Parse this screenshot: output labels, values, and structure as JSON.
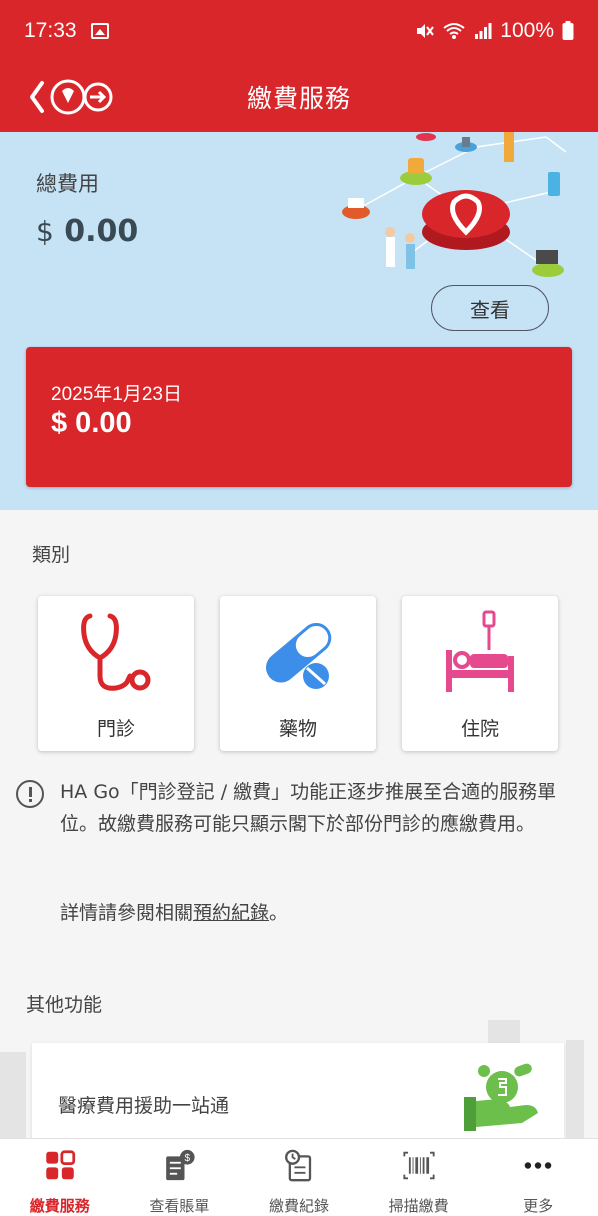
{
  "status_bar": {
    "time": "17:33",
    "battery": "100%"
  },
  "app_bar": {
    "title": "繳費服務"
  },
  "summary": {
    "total_label": "總費用",
    "total_currency": "$",
    "total_amount": "0.00",
    "view_button": "查看"
  },
  "due_card": {
    "date": "2025年1月23日",
    "amount": "$ 0.00"
  },
  "categories": {
    "heading": "類別",
    "items": [
      {
        "label": "門診",
        "icon": "stethoscope-icon",
        "color": "#d9262a"
      },
      {
        "label": "藥物",
        "icon": "pill-capsule-icon",
        "color": "#3d8ee8"
      },
      {
        "label": "住院",
        "icon": "hospital-bed-icon",
        "color": "#e54a8e"
      }
    ]
  },
  "notice": {
    "text": "HA Go「門診登記 / 繳費」功能正逐步推展至合適的服務單位。故繳費服務可能只顯示閣下於部份門診的應繳費用。",
    "more_prefix": "詳情請參閱相關",
    "more_link": "預約紀錄",
    "more_suffix": "。"
  },
  "other_functions": {
    "heading": "其他功能",
    "items": [
      {
        "label": "醫療費用援助一站通",
        "icon": "money-hand-icon"
      }
    ]
  },
  "bottom_nav": {
    "items": [
      {
        "label": "繳費服務",
        "icon": "grid-icon",
        "active": true
      },
      {
        "label": "查看賬單",
        "icon": "bill-icon",
        "active": false
      },
      {
        "label": "繳費紀錄",
        "icon": "history-icon",
        "active": false
      },
      {
        "label": "掃描繳費",
        "icon": "barcode-icon",
        "active": false
      },
      {
        "label": "更多",
        "icon": "more-icon",
        "active": false
      }
    ]
  },
  "colors": {
    "brand_red": "#d9262a",
    "hero_blue": "#c6e3f6"
  }
}
